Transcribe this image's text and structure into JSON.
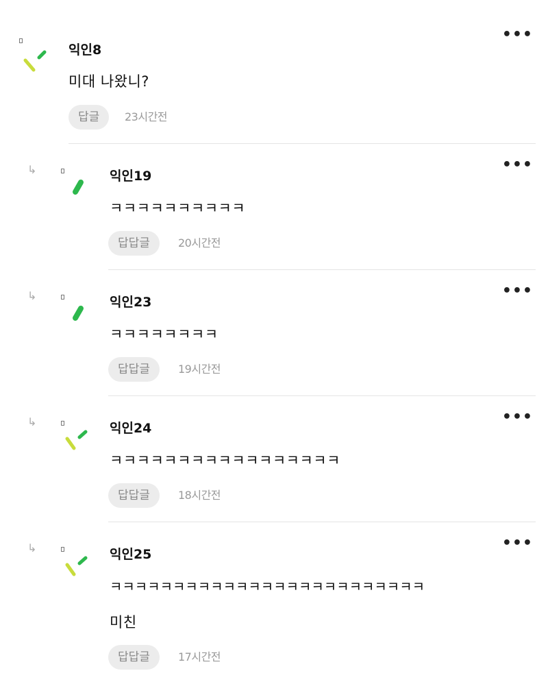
{
  "comments": [
    {
      "author": "익인8",
      "text": "미대 나왔니?",
      "reply_label": "답글",
      "time": "23시간전",
      "avatar": "two-stroke-lime-green"
    },
    {
      "author": "익인19",
      "text": "ㅋㅋㅋㅋㅋㅋㅋㅋㅋㅋ",
      "reply_label": "답답글",
      "time": "20시간전",
      "avatar": "single-stroke-green"
    },
    {
      "author": "익인23",
      "text": "ㅋㅋㅋㅋㅋㅋㅋㅋ",
      "reply_label": "답답글",
      "time": "19시간전",
      "avatar": "single-stroke-green"
    },
    {
      "author": "익인24",
      "text": "ㅋㅋㅋㅋㅋㅋㅋㅋㅋㅋㅋㅋㅋㅋㅋㅋㅋ",
      "reply_label": "답답글",
      "time": "18시간전",
      "avatar": "two-stroke-lime-green"
    },
    {
      "author": "익인25",
      "text": "ㅋㅋㅋㅋㅋㅋㅋㅋㅋㅋㅋㅋㅋㅋㅋㅋㅋㅋㅋㅋㅋㅋㅋㅋㅋ",
      "text2": "미친",
      "reply_label": "답답글",
      "time": "17시간전",
      "avatar": "two-stroke-lime-green"
    }
  ],
  "more_icon": "more-horizontal-icon",
  "reply_arrow_icon": "reply-arrow-icon",
  "colors": {
    "lime": "#c8dc3c",
    "green": "#2db84d",
    "button_bg": "#ececec",
    "divider": "#e4e4e4"
  }
}
